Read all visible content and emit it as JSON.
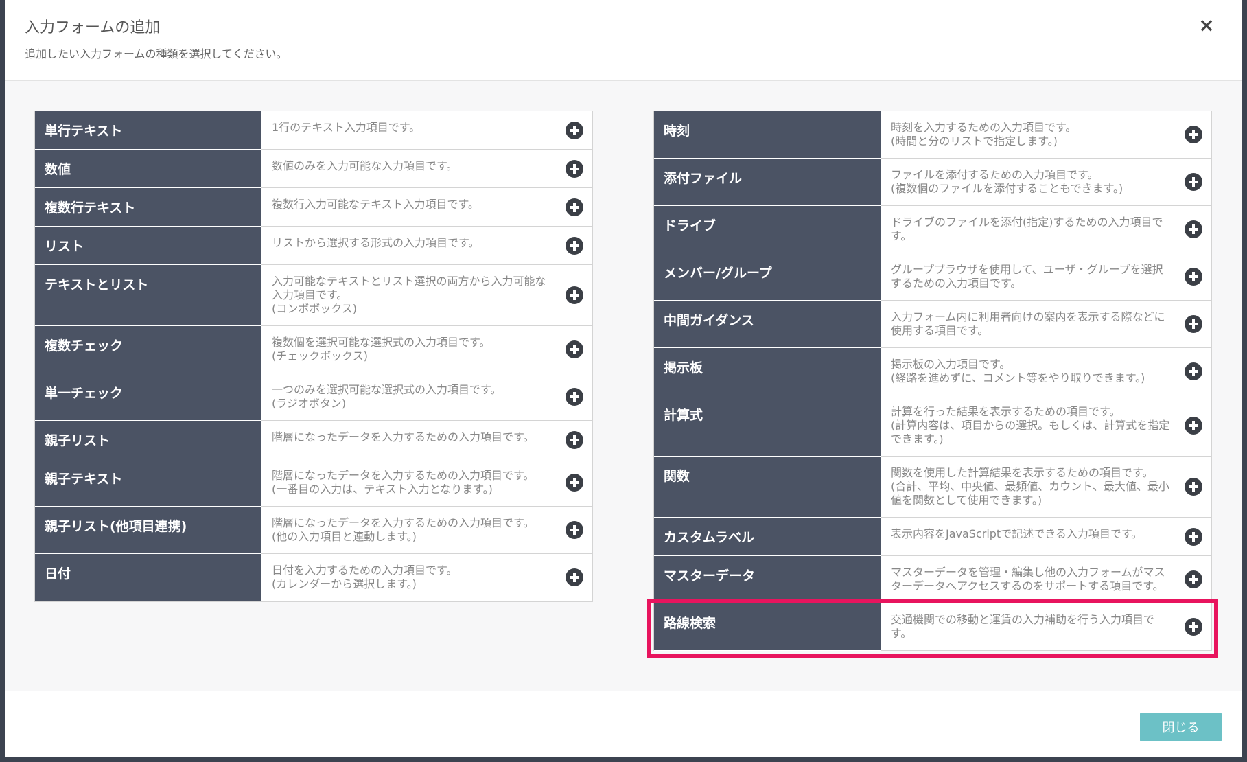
{
  "header": {
    "title": "入力フォームの追加",
    "subtitle": "追加したい入力フォームの種類を選択してください。",
    "close_icon": "×"
  },
  "left_items": [
    {
      "name": "単行テキスト",
      "desc": [
        "1行のテキスト入力項目です。"
      ]
    },
    {
      "name": "数値",
      "desc": [
        "数値のみを入力可能な入力項目です。"
      ]
    },
    {
      "name": "複数行テキスト",
      "desc": [
        "複数行入力可能なテキスト入力項目です。"
      ]
    },
    {
      "name": "リスト",
      "desc": [
        "リストから選択する形式の入力項目です。"
      ]
    },
    {
      "name": "テキストとリスト",
      "desc": [
        "入力可能なテキストとリスト選択の両方から入力可能な入力項目です。",
        "(コンボボックス)"
      ]
    },
    {
      "name": "複数チェック",
      "desc": [
        "複数個を選択可能な選択式の入力項目です。",
        "(チェックボックス)"
      ]
    },
    {
      "name": "単一チェック",
      "desc": [
        "一つのみを選択可能な選択式の入力項目です。",
        "(ラジオボタン)"
      ]
    },
    {
      "name": "親子リスト",
      "desc": [
        "階層になったデータを入力するための入力項目です。"
      ]
    },
    {
      "name": "親子テキスト",
      "desc": [
        "階層になったデータを入力するための入力項目です。",
        "(一番目の入力は、テキスト入力となります。)"
      ]
    },
    {
      "name": "親子リスト(他項目連携)",
      "desc": [
        "階層になったデータを入力するための入力項目です。",
        "(他の入力項目と連動します。)"
      ]
    },
    {
      "name": "日付",
      "desc": [
        "日付を入力するための入力項目です。",
        "(カレンダーから選択します。)"
      ]
    }
  ],
  "right_items": [
    {
      "name": "時刻",
      "desc": [
        "時刻を入力するための入力項目です。",
        "(時間と分のリストで指定します。)"
      ]
    },
    {
      "name": "添付ファイル",
      "desc": [
        "ファイルを添付するための入力項目です。",
        "(複数個のファイルを添付することもできます。)"
      ]
    },
    {
      "name": "ドライブ",
      "desc": [
        "ドライブのファイルを添付(指定)するための入力項目です。"
      ]
    },
    {
      "name": "メンバー/グループ",
      "desc": [
        "グループブラウザを使用して、ユーザ・グループを選択するための入力項目です。"
      ]
    },
    {
      "name": "中間ガイダンス",
      "desc": [
        "入力フォーム内に利用者向けの案内を表示する際などに使用する項目です。"
      ]
    },
    {
      "name": "掲示板",
      "desc": [
        "掲示板の入力項目です。",
        "(経路を進めずに、コメント等をやり取りできます。)"
      ]
    },
    {
      "name": "計算式",
      "desc": [
        "計算を行った結果を表示するための項目です。",
        "(計算内容は、項目からの選択。もしくは、計算式を指定できます。)"
      ]
    },
    {
      "name": "関数",
      "desc": [
        "関数を使用した計算結果を表示するための項目です。",
        "(合計、平均、中央値、最頻値、カウント、最大値、最小値を関数として使用できます。)"
      ]
    },
    {
      "name": "カスタムラベル",
      "desc": [
        "表示内容をJavaScriptで記述できる入力項目です。"
      ]
    },
    {
      "name": "マスターデータ",
      "desc": [
        "マスターデータを管理・編集し他の入力フォームがマスターデータへアクセスするのをサポートする項目です。"
      ]
    },
    {
      "name": "路線検索",
      "desc": [
        "交通機関での移動と運賃の入力補助を行う入力項目です。"
      ]
    }
  ],
  "footer": {
    "close_label": "閉じる"
  },
  "colors": {
    "name_cell_bg": "#4b5364",
    "highlight_border": "#e8145e",
    "close_button_bg": "#6cc1c6"
  },
  "icons": {
    "add": "plus-circle-icon",
    "close": "close-icon"
  }
}
